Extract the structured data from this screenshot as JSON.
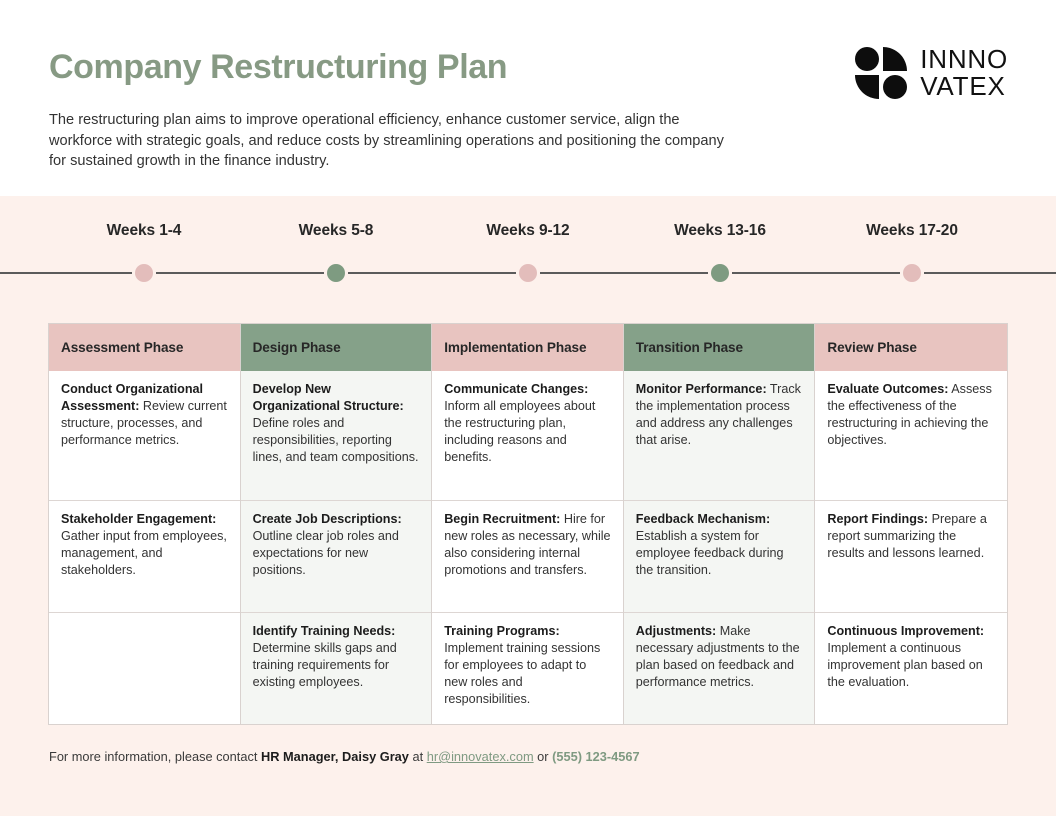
{
  "header": {
    "title": "Company Restructuring Plan",
    "subtitle": "The restructuring plan aims to improve operational efficiency, enhance customer service, align the workforce with strategic goals, and reduce costs by streamlining operations and positioning the company for sustained growth in the finance industry.",
    "logo": {
      "line1": "INNNO",
      "line2": "VATEX"
    }
  },
  "colors": {
    "title_green": "#879a84",
    "band_background": "#fdf1ec",
    "header_pink": "#e8c4c0",
    "header_green": "#85a189",
    "dot_pink": "#e3bdbb",
    "dot_green": "#7e9b81",
    "timeline_line": "#5b5b5b",
    "accent_link": "#7f9a82"
  },
  "timeline": [
    {
      "label": "Weeks 1-4",
      "dot": "pink"
    },
    {
      "label": "Weeks 5-8",
      "dot": "green"
    },
    {
      "label": "Weeks 9-12",
      "dot": "pink"
    },
    {
      "label": "Weeks 13-16",
      "dot": "green"
    },
    {
      "label": "Weeks 17-20",
      "dot": "pink"
    }
  ],
  "table": {
    "columns": [
      {
        "header": "Assessment Phase",
        "header_style": "pink",
        "body_tint": "white",
        "cells": [
          {
            "title": "Conduct Organizational Assessment:",
            "text": "Review current structure, processes, and performance metrics."
          },
          {
            "title": "Stakeholder Engagement:",
            "text": "Gather input from employees, management, and stakeholders."
          },
          {
            "title": "",
            "text": ""
          }
        ]
      },
      {
        "header": "Design Phase",
        "header_style": "green",
        "body_tint": "green",
        "cells": [
          {
            "title": "Develop New Organizational Structure:",
            "text": "Define roles and responsibilities, reporting lines, and team compositions."
          },
          {
            "title": "Create Job Descriptions:",
            "text": "Outline clear job roles and expectations for new positions."
          },
          {
            "title": "Identify Training Needs:",
            "text": "Determine skills gaps and training requirements for existing employees."
          }
        ]
      },
      {
        "header": "Implementation Phase",
        "header_style": "pink",
        "body_tint": "white",
        "cells": [
          {
            "title": "Communicate Changes:",
            "text": "Inform all employees about the restructuring plan, including reasons and benefits."
          },
          {
            "title": "Begin Recruitment:",
            "text": "Hire for new roles as necessary, while also considering internal promotions and transfers."
          },
          {
            "title": "Training Programs:",
            "text": "Implement training sessions for employees to adapt to new roles and responsibilities."
          }
        ]
      },
      {
        "header": "Transition Phase",
        "header_style": "green",
        "body_tint": "green",
        "cells": [
          {
            "title": "Monitor Performance:",
            "text": "Track the implementation process and address any challenges that arise."
          },
          {
            "title": "Feedback Mechanism:",
            "text": "Establish a system for employee feedback during the transition."
          },
          {
            "title": "Adjustments:",
            "text": "Make necessary adjustments to the plan based on feedback and performance metrics."
          }
        ]
      },
      {
        "header": "Review Phase",
        "header_style": "pink",
        "body_tint": "white",
        "cells": [
          {
            "title": "Evaluate Outcomes:",
            "text": "Assess the effectiveness of the restructuring in achieving the objectives."
          },
          {
            "title": "Report Findings:",
            "text": "Prepare a report summarizing the results and lessons learned."
          },
          {
            "title": "Continuous Improvement:",
            "text": "Implement a continuous improvement plan based on the evaluation."
          }
        ]
      }
    ]
  },
  "footer": {
    "lead": "For more information, please contact ",
    "contact_name": "HR Manager, Daisy Gray",
    "at": " at ",
    "email": "hr@innovatex.com",
    "or": " or ",
    "phone": "(555) 123-4567"
  }
}
